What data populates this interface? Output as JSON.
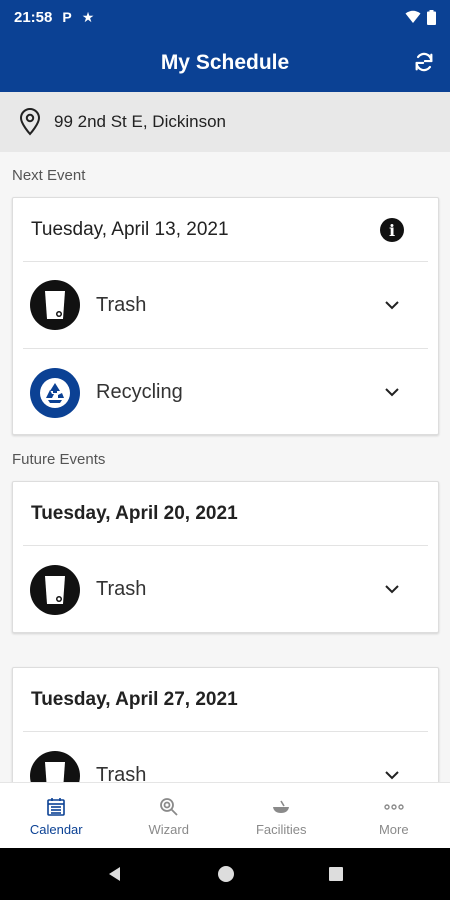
{
  "status_bar": {
    "time": "21:58",
    "icon_p": "P",
    "icon_star": "★"
  },
  "app_bar": {
    "title": "My Schedule"
  },
  "address": {
    "text": "99 2nd St E, Dickinson"
  },
  "next_event": {
    "section_label": "Next Event",
    "date": "Tuesday, April 13, 2021",
    "items": [
      {
        "label": "Trash",
        "icon": "trash-bin-icon"
      },
      {
        "label": "Recycling",
        "icon": "recycle-icon"
      }
    ]
  },
  "future_events": {
    "section_label": "Future Events",
    "cards": [
      {
        "date": "Tuesday, April 20, 2021",
        "items": [
          {
            "label": "Trash",
            "icon": "trash-bin-icon"
          }
        ]
      },
      {
        "date": "Tuesday, April 27, 2021",
        "items": [
          {
            "label": "Trash",
            "icon": "trash-bin-icon"
          }
        ]
      }
    ]
  },
  "bottom_nav": [
    {
      "label": "Calendar",
      "icon": "calendar-icon",
      "active": true
    },
    {
      "label": "Wizard",
      "icon": "search-icon",
      "active": false
    },
    {
      "label": "Facilities",
      "icon": "facility-icon",
      "active": false
    },
    {
      "label": "More",
      "icon": "more-icon",
      "active": false
    }
  ],
  "colors": {
    "primary": "#0b4194",
    "trash_icon_bg": "#111111",
    "active_nav": "#0b4194"
  }
}
